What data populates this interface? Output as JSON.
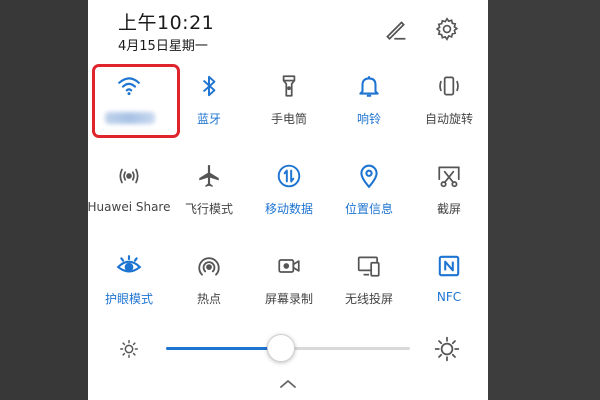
{
  "status": {
    "time": "上午10:21",
    "date": "4月15日星期一"
  },
  "header": {
    "edit_icon": "edit-pencil-icon",
    "settings_icon": "gear-icon"
  },
  "tiles": [
    {
      "id": "wifi",
      "label": "",
      "icon": "wifi-icon",
      "active": true,
      "label_obscured": true
    },
    {
      "id": "bluetooth",
      "label": "蓝牙",
      "icon": "bluetooth-icon",
      "active": true
    },
    {
      "id": "flashlight",
      "label": "手电筒",
      "icon": "flashlight-icon",
      "active": false
    },
    {
      "id": "ring",
      "label": "响铃",
      "icon": "bell-icon",
      "active": true
    },
    {
      "id": "rotate",
      "label": "自动旋转",
      "icon": "auto-rotate-icon",
      "active": false
    },
    {
      "id": "share",
      "label": "Huawei Share",
      "icon": "huawei-share-icon",
      "active": false
    },
    {
      "id": "airplane",
      "label": "飞行模式",
      "icon": "airplane-icon",
      "active": false
    },
    {
      "id": "mobile-data",
      "label": "移动数据",
      "icon": "mobile-data-icon",
      "active": true
    },
    {
      "id": "location",
      "label": "位置信息",
      "icon": "location-pin-icon",
      "active": true
    },
    {
      "id": "screenshot",
      "label": "截屏",
      "icon": "screenshot-scissors-icon",
      "active": false
    },
    {
      "id": "eye-comfort",
      "label": "护眼模式",
      "icon": "eye-icon",
      "active": true
    },
    {
      "id": "hotspot",
      "label": "热点",
      "icon": "hotspot-icon",
      "active": false
    },
    {
      "id": "screen-record",
      "label": "屏幕录制",
      "icon": "video-camera-icon",
      "active": false
    },
    {
      "id": "wireless-projection",
      "label": "无线投屏",
      "icon": "projection-icon",
      "active": false
    },
    {
      "id": "nfc",
      "label": "NFC",
      "icon": "nfc-icon",
      "active": true
    }
  ],
  "brightness": {
    "level": 0.47,
    "low_icon": "brightness-low-icon",
    "high_icon": "brightness-high-icon"
  },
  "colors": {
    "accent": "#1e74d1",
    "inactive": "#555555",
    "highlight": "#e0242c"
  }
}
